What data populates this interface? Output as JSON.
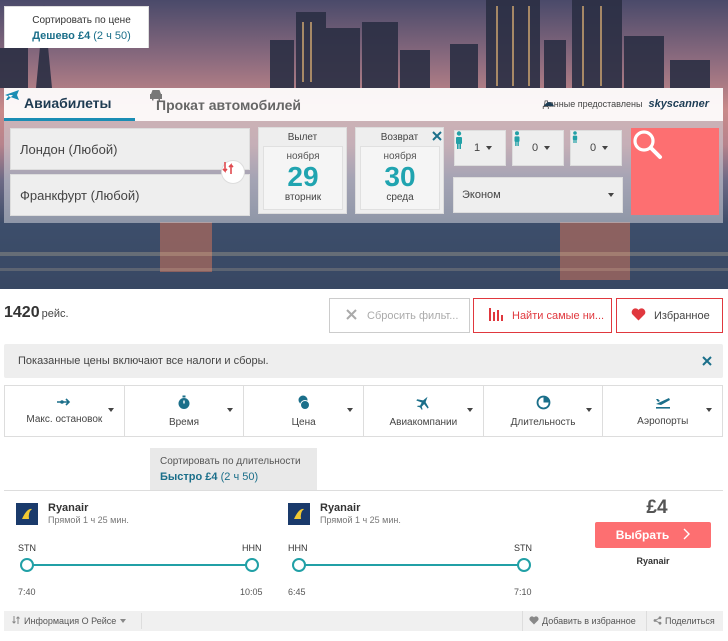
{
  "header": {
    "tabs": [
      {
        "label": "Авиабилеты",
        "icon": "plane-icon",
        "active": true
      },
      {
        "label": "Прокат автомобилей",
        "icon": "car-icon",
        "active": false
      }
    ],
    "provider_text": "Данные предоставлены",
    "provider_brand": "skyscanner"
  },
  "search": {
    "from": "Лондон (Любой)",
    "to": "Франкфурт (Любой)",
    "departure": {
      "label": "Вылет",
      "month": "ноября",
      "day": "29",
      "weekday": "вторник"
    },
    "return": {
      "label": "Возврат",
      "month": "ноября",
      "day": "30",
      "weekday": "среда"
    },
    "passengers": {
      "adults": "1",
      "children": "0",
      "infants": "0"
    },
    "cabin": "Эконом"
  },
  "toolbar": {
    "count": "1420",
    "count_unit": "рейс.",
    "reset_label": "Сбросить фильт...",
    "cheapest_label": "Найти самые ни...",
    "favorites_label": "Избранное"
  },
  "notice": "Показанные цены включают все налоги и сборы.",
  "filters": [
    {
      "label": "Макс. остановок",
      "icon": "stops-icon"
    },
    {
      "label": "Время",
      "icon": "stopwatch-icon"
    },
    {
      "label": "Цена",
      "icon": "coins-icon"
    },
    {
      "label": "Авиакомпании",
      "icon": "plane-icon"
    },
    {
      "label": "Длительность",
      "icon": "clock-icon"
    },
    {
      "label": "Аэропорты",
      "icon": "takeoff-icon"
    }
  ],
  "sort": {
    "price": {
      "title": "Сортировать по цене",
      "sub": "Дешево £4",
      "paren": "(2 ч 50)"
    },
    "duration": {
      "title": "Сортировать по длительности",
      "sub": "Быстро £4",
      "paren": "(2 ч 50)"
    }
  },
  "result": {
    "outbound": {
      "airline": "Ryanair",
      "info": "Прямой   1 ч 25 мин.",
      "from": "STN",
      "to": "HHN",
      "dep": "7:40",
      "arr": "10:05"
    },
    "inbound": {
      "airline": "Ryanair",
      "info": "Прямой   1 ч 25 мин.",
      "from": "HHN",
      "to": "STN",
      "dep": "6:45",
      "arr": "7:10"
    },
    "price": "£4",
    "select_label": "Выбрать",
    "price_airline": "Ryanair",
    "footer": {
      "info": "Информация О Рейсе",
      "add": "Добавить в избранное",
      "share": "Поделиться"
    }
  },
  "colors": {
    "accent": "#20a4b0",
    "cta": "#fd6f71",
    "alert": "#e0383e"
  }
}
